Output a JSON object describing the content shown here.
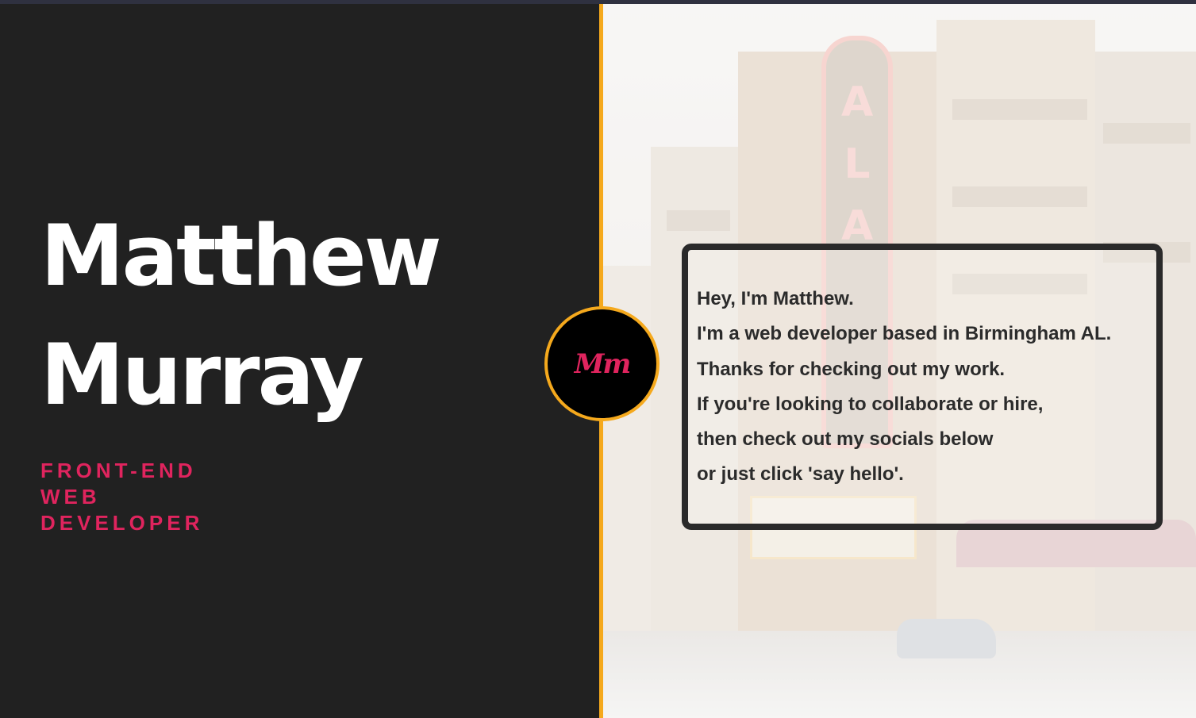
{
  "profile": {
    "first_name": "Matthew",
    "last_name": "Murray",
    "role_lines": [
      "FRONT-END",
      "WEB",
      "DEVELOPER"
    ],
    "monogram": "Mm"
  },
  "intro": {
    "lines": [
      "Hey, I'm Matthew.",
      "I'm a web developer based in Birmingham AL.",
      "Thanks for checking out my work.",
      "If you're looking to collaborate or hire,",
      "then check out my socials below",
      "or just click 'say hello'."
    ]
  },
  "background": {
    "sign_letters": "ALA"
  },
  "colors": {
    "left_bg": "#212121",
    "accent_pink": "#e0245e",
    "accent_gold": "#f5a91d",
    "name_text": "#ffffff",
    "card_border": "#2a2a2a"
  }
}
